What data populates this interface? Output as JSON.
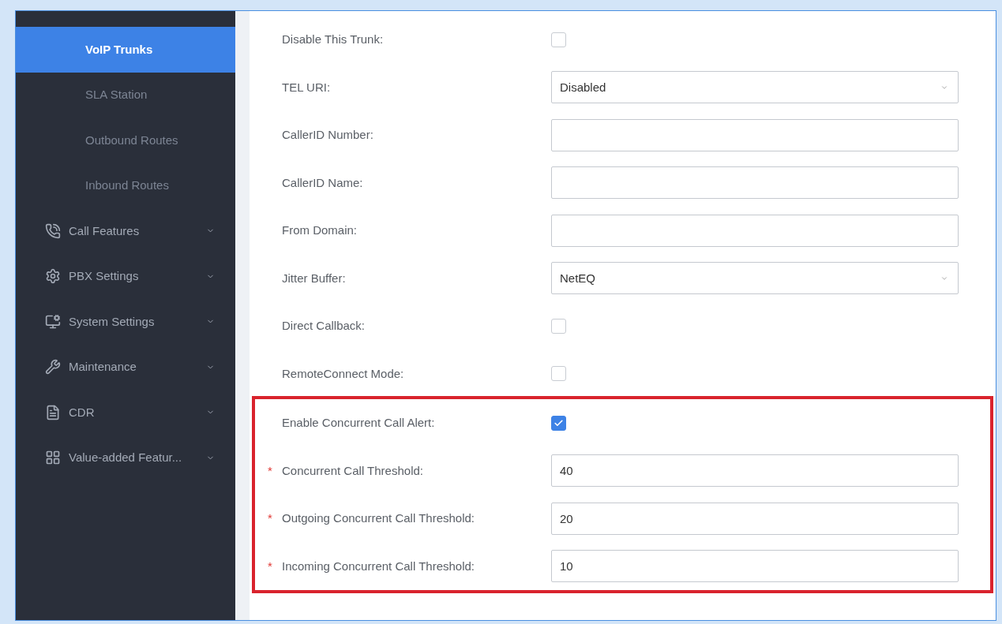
{
  "sidebar": {
    "items": [
      {
        "kind": "sub",
        "label": "VoIP Trunks",
        "selected": true
      },
      {
        "kind": "sub",
        "label": "SLA Station",
        "selected": false
      },
      {
        "kind": "sub",
        "label": "Outbound Routes",
        "selected": false
      },
      {
        "kind": "sub",
        "label": "Inbound Routes",
        "selected": false
      },
      {
        "kind": "group",
        "label": "Call Features"
      },
      {
        "kind": "group",
        "label": "PBX Settings"
      },
      {
        "kind": "group",
        "label": "System Settings"
      },
      {
        "kind": "group",
        "label": "Maintenance"
      },
      {
        "kind": "group",
        "label": "CDR"
      },
      {
        "kind": "group",
        "label": "Value-added Featur..."
      }
    ]
  },
  "form": {
    "fields": [
      {
        "kind": "checkbox",
        "label": "Disable This Trunk:",
        "checked": false
      },
      {
        "kind": "select",
        "label": "TEL URI:",
        "value": "Disabled"
      },
      {
        "kind": "text",
        "label": "CallerID Number:"
      },
      {
        "kind": "text",
        "label": "CallerID Name:"
      },
      {
        "kind": "text",
        "label": "From Domain:"
      },
      {
        "kind": "select",
        "label": "Jitter Buffer:",
        "value": "NetEQ"
      },
      {
        "kind": "checkbox",
        "label": "Direct Callback:",
        "checked": false
      },
      {
        "kind": "checkbox",
        "label": "RemoteConnect Mode:",
        "checked": false
      }
    ],
    "highlighted_section": {
      "fields": [
        {
          "kind": "checkbox",
          "label": "Enable Concurrent Call Alert:",
          "checked": true
        },
        {
          "kind": "text",
          "label": "Concurrent Call Threshold:",
          "required_mark": "*",
          "value": "40"
        },
        {
          "kind": "text",
          "label": "Outgoing Concurrent Call Threshold:",
          "required_mark": "*",
          "value": "20"
        },
        {
          "kind": "text",
          "label": "Incoming Concurrent Call Threshold:",
          "required_mark": "*",
          "value": "10"
        }
      ]
    }
  }
}
